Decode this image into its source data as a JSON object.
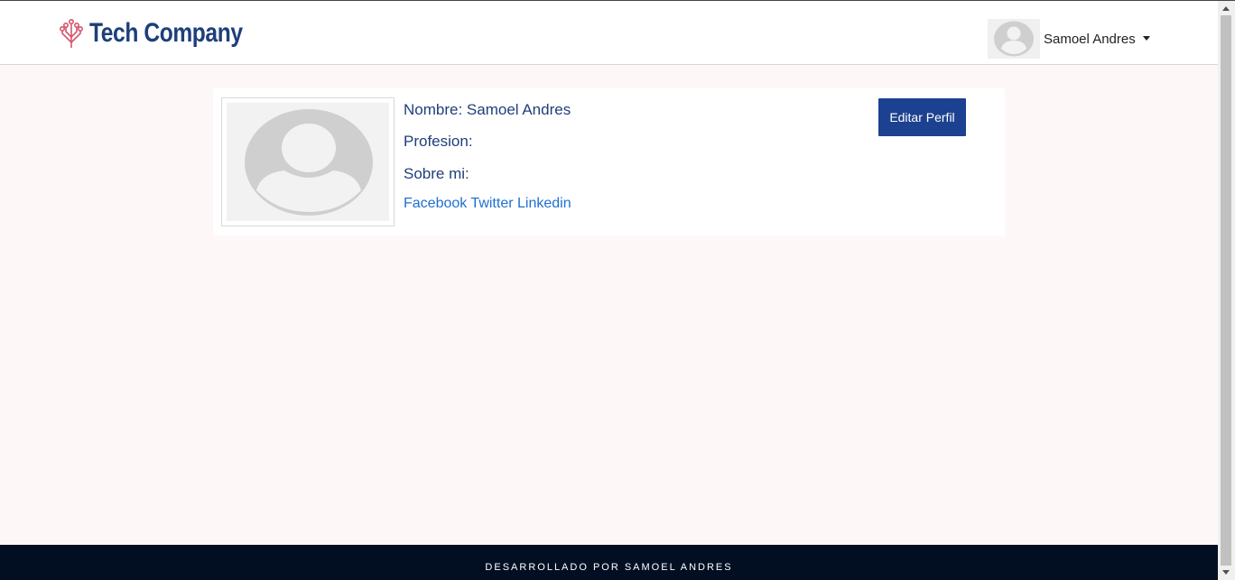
{
  "header": {
    "brand_name": "Tech Company",
    "user_name": "Samoel Andres"
  },
  "profile": {
    "name_line": "Nombre: Samoel Andres",
    "profession_line": "Profesion:",
    "about_line": "Sobre mi:",
    "links": {
      "facebook": "Facebook",
      "twitter": "Twitter",
      "linkedin": "Linkedin"
    },
    "edit_button": "Editar Perfil"
  },
  "footer": {
    "text": "DESARROLLADO POR SAMOEL ANDRES"
  },
  "colors": {
    "primary": "#1c4190",
    "brand_text": "#1e3f7a",
    "link": "#1f6fd1",
    "footer_bg": "#020f23",
    "page_bg": "#fdf8f7"
  }
}
